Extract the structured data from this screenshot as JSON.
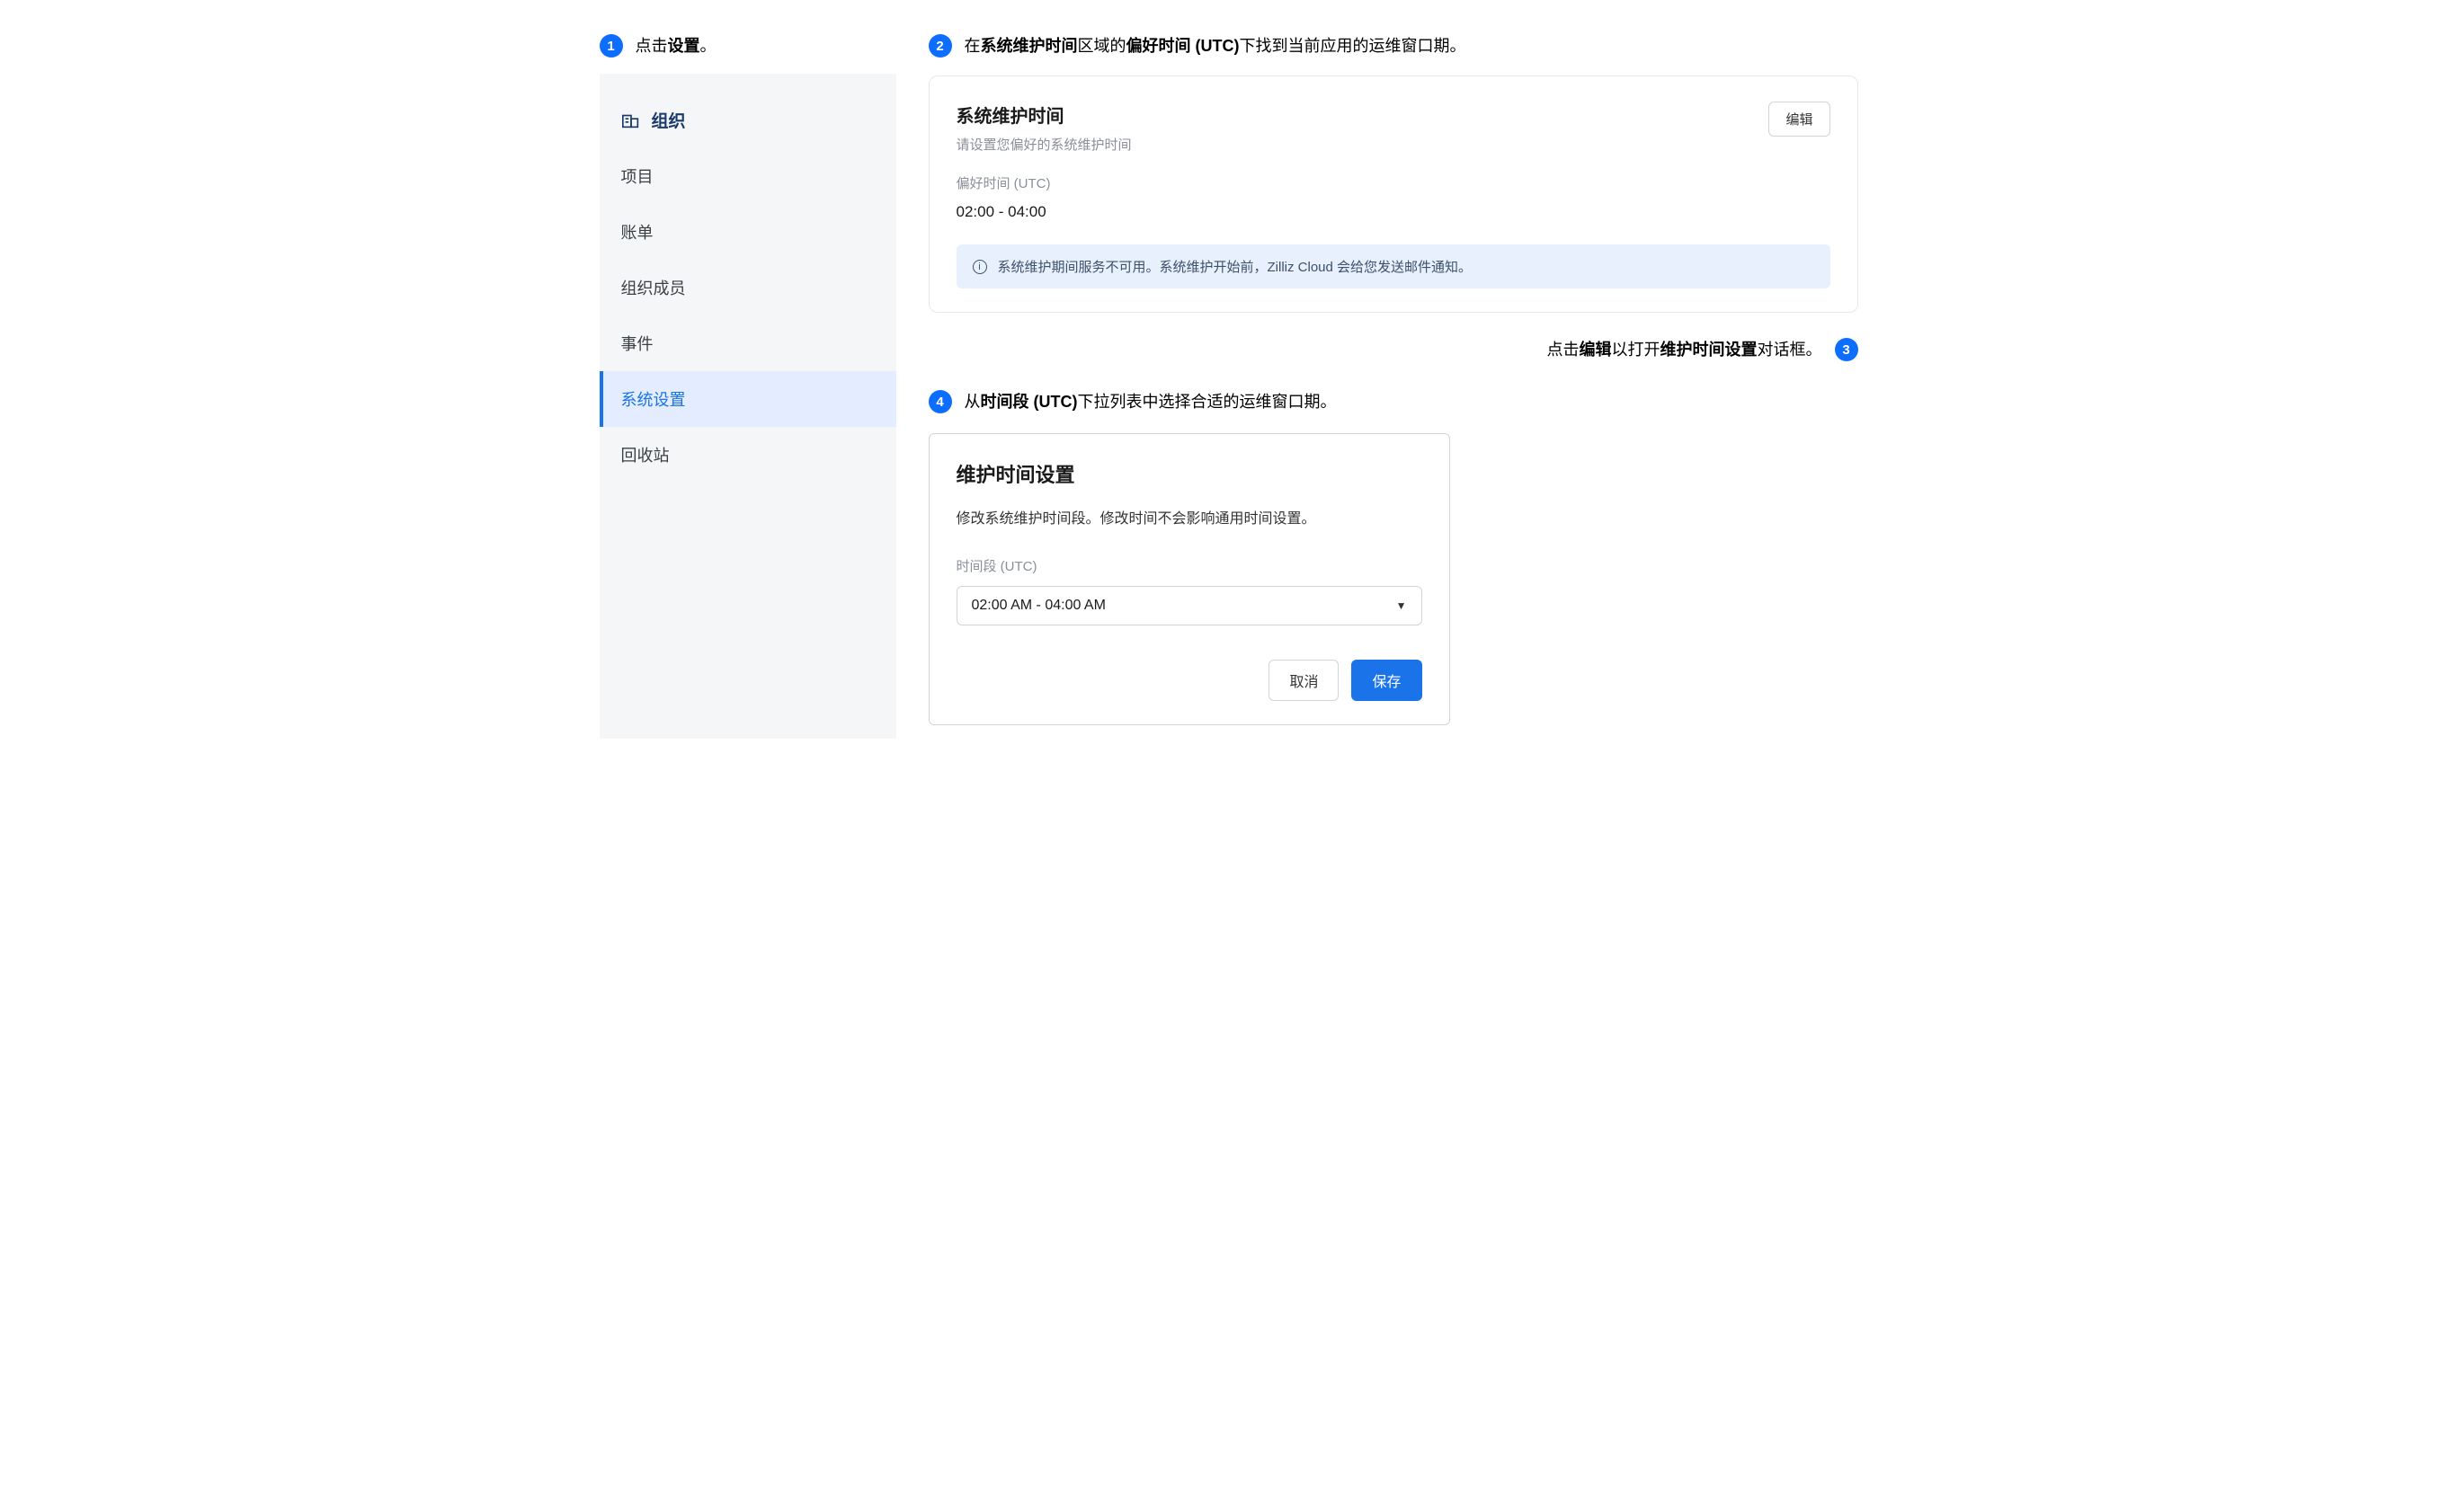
{
  "steps": {
    "s1": {
      "num": "1",
      "pre": "点击",
      "bold1": "设置",
      "post": "。"
    },
    "s2": {
      "num": "2",
      "pre": "在",
      "bold1": "系统维护时间",
      "mid1": "区域的",
      "bold2": "偏好时间 (UTC)",
      "post": "下找到当前应用的运维窗口期。"
    },
    "s3": {
      "num": "3",
      "pre": "点击",
      "bold1": "编辑",
      "mid1": "以打开",
      "bold2": "维护时间设置",
      "post": "对话框。"
    },
    "s4": {
      "num": "4",
      "pre": "从",
      "bold1": "时间段 (UTC)",
      "post": "下拉列表中选择合适的运维窗口期。"
    }
  },
  "sidebar": {
    "org_label": "组织",
    "items": [
      {
        "label": "项目"
      },
      {
        "label": "账单"
      },
      {
        "label": "组织成员"
      },
      {
        "label": "事件"
      },
      {
        "label": "系统设置"
      },
      {
        "label": "回收站"
      }
    ]
  },
  "panel": {
    "title": "系统维护时间",
    "subtitle": "请设置您偏好的系统维护时间",
    "edit_label": "编辑",
    "field_label": "偏好时间 (UTC)",
    "field_value": "02:00 - 04:00",
    "info_text": "系统维护期间服务不可用。系统维护开始前，Zilliz Cloud 会给您发送邮件通知。"
  },
  "dialog": {
    "title": "维护时间设置",
    "desc": "修改系统维护时间段。修改时间不会影响通用时间设置。",
    "field_label": "时间段 (UTC)",
    "selected": "02:00 AM - 04:00 AM",
    "cancel": "取消",
    "save": "保存"
  }
}
